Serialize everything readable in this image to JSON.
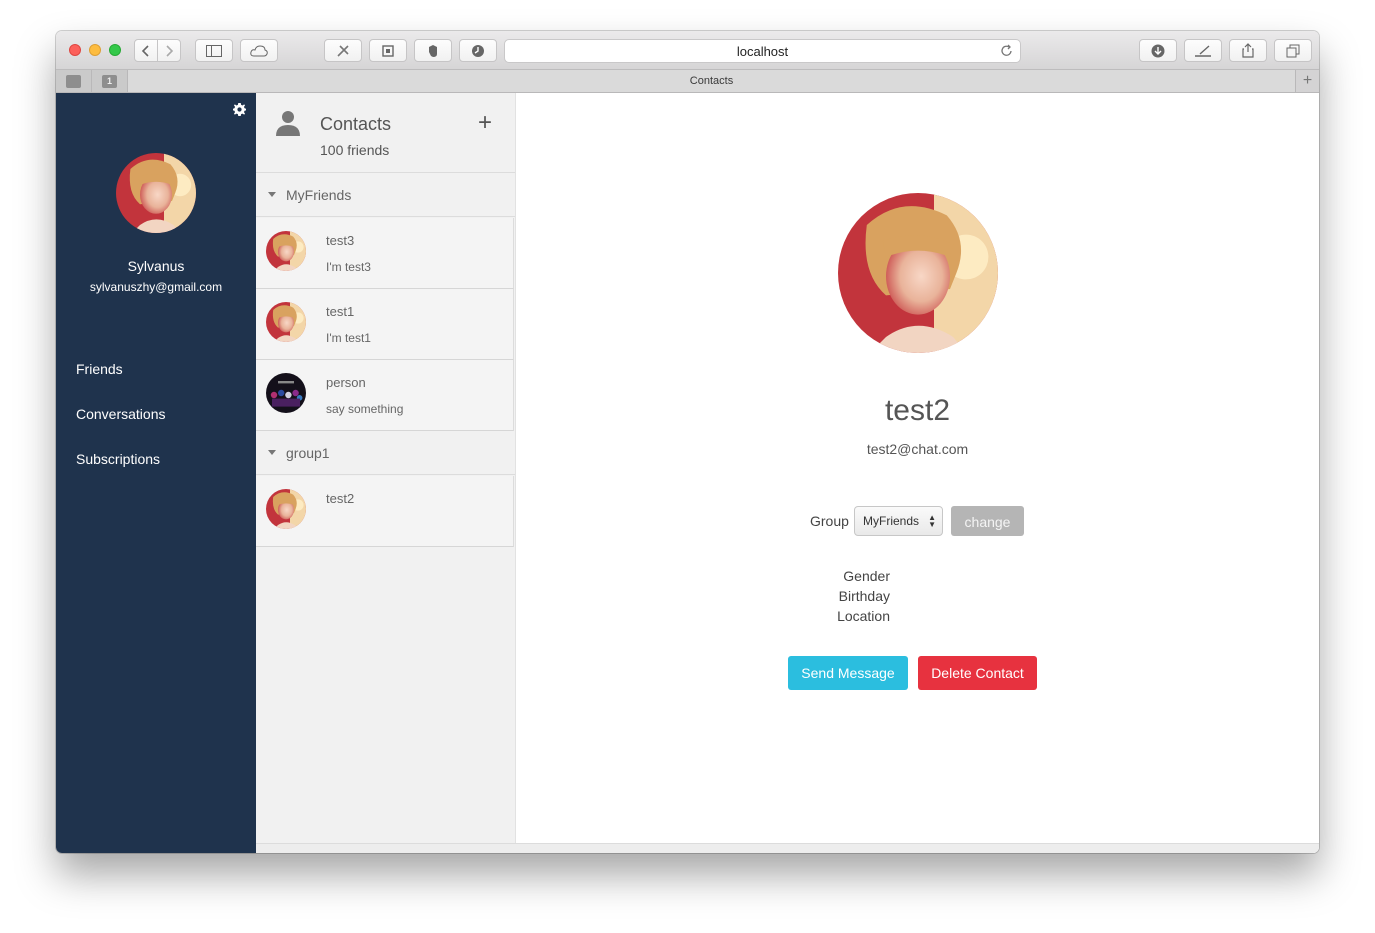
{
  "browser": {
    "url": "localhost",
    "tab_title": "Contacts",
    "tab_badges": [
      "",
      "1"
    ],
    "new_tab": "+"
  },
  "sidebar": {
    "user_name": "Sylvanus",
    "user_email": "sylvanuszhy@gmail.com",
    "nav": [
      "Friends",
      "Conversations",
      "Subscriptions"
    ]
  },
  "contacts": {
    "title": "Contacts",
    "count": "100 friends",
    "add_label": "+",
    "groups": [
      {
        "name": "MyFriends",
        "items": [
          {
            "name": "test3",
            "status": "I'm test3"
          },
          {
            "name": "test1",
            "status": "I'm test1"
          },
          {
            "name": "person",
            "status": "say something"
          }
        ]
      },
      {
        "name": "group1",
        "items": [
          {
            "name": "test2",
            "status": ""
          }
        ]
      }
    ]
  },
  "detail": {
    "name": "test2",
    "email": "test2@chat.com",
    "group_label": "Group",
    "group_value": "MyFriends",
    "change_label": "change",
    "fields": [
      "Gender",
      "Birthday",
      "Location"
    ],
    "send_label": "Send Message",
    "delete_label": "Delete Contact"
  },
  "colors": {
    "sidebar_bg": "#1f334d",
    "send": "#2bbedf",
    "delete": "#e7323f",
    "change": "#b5b5b5"
  }
}
